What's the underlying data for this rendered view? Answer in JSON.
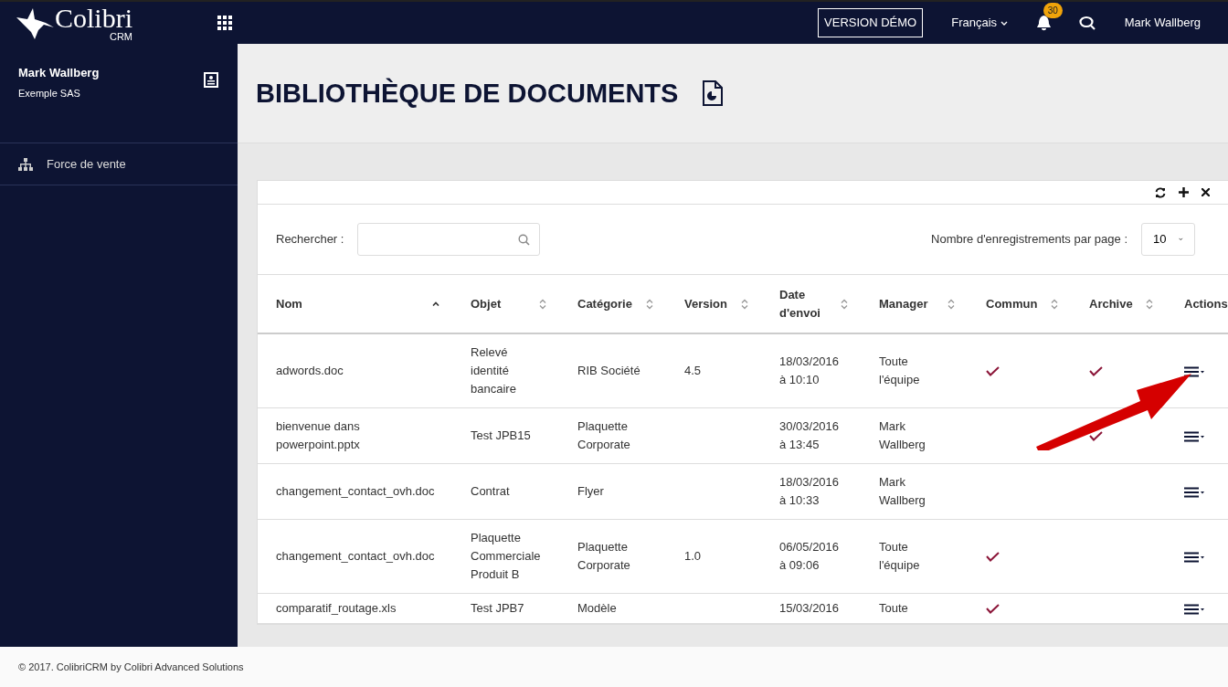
{
  "brand": {
    "name": "Colibri",
    "sub": "CRM"
  },
  "topbar": {
    "demo_label": "VERSION DÉMO",
    "language": "Français",
    "notifications": "30",
    "user": "Mark Wallberg"
  },
  "sidebar": {
    "user_name": "Mark Wallberg",
    "company": "Exemple SAS",
    "items": [
      {
        "label": "Force de vente",
        "selected": false
      }
    ]
  },
  "page_title": "BIBLIOTHÈQUE DE DOCUMENTS",
  "toolbar": {
    "search_label": "Rechercher :",
    "per_page_label": "Nombre d'enregistrements par page :",
    "per_page": "10"
  },
  "table": {
    "columns": [
      {
        "label": "Nom",
        "sortable": true,
        "sorted": true
      },
      {
        "label": "Objet",
        "sortable": true,
        "sorted": false
      },
      {
        "label": "Catégorie",
        "sortable": true,
        "sorted": false
      },
      {
        "label": "Version",
        "sortable": true,
        "sorted": false
      },
      {
        "label": "Date d'envoi",
        "sortable": true,
        "sorted": false
      },
      {
        "label": "Manager",
        "sortable": true,
        "sorted": false
      },
      {
        "label": "Commun",
        "sortable": true,
        "sorted": false
      },
      {
        "label": "Archive",
        "sortable": true,
        "sorted": false
      },
      {
        "label": "Actions",
        "sortable": false
      }
    ],
    "rows": [
      {
        "name": "adwords.doc",
        "object": "Relevé identité bancaire",
        "category": "RIB Société",
        "version": "4.5",
        "date": "18/03/2016 à 10:10",
        "manager": "Toute l'équipe",
        "common": true,
        "archive": true
      },
      {
        "name": "bienvenue dans powerpoint.pptx",
        "object": "Test JPB15",
        "category": "Plaquette Corporate",
        "date": "30/03/2016 à 13:45",
        "manager": "Mark Wallberg",
        "common": false,
        "archive": true
      },
      {
        "name": "changement_contact_ovh.doc",
        "object": "Contrat",
        "category": "Flyer",
        "date": "18/03/2016 à 10:33",
        "manager": "Mark Wallberg",
        "common": false,
        "archive": false
      },
      {
        "name": "changement_contact_ovh.doc",
        "object": "Plaquette Commerciale Produit B",
        "category": "Plaquette Corporate",
        "version": "1.0",
        "date": "06/05/2016 à 09:06",
        "manager": "Toute l'équipe",
        "common": true,
        "archive": false
      },
      {
        "name": "comparatif_routage.xls",
        "object": "Test JPB7",
        "category": "Modèle",
        "date": "15/03/2016",
        "manager": "Toute",
        "common": true,
        "archive": false
      }
    ]
  },
  "footer": "© 2017. ColibriCRM by Colibri Advanced Solutions"
}
